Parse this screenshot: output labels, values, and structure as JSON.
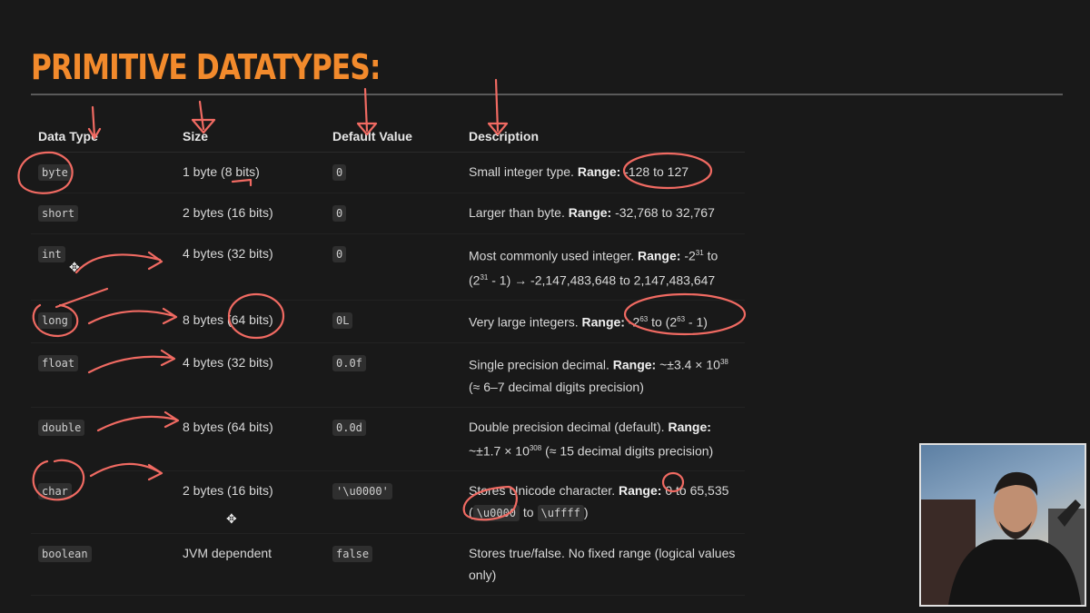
{
  "title": "PRIMITIVE DATATYPES:",
  "headers": {
    "data_type": "Data Type",
    "size": "Size",
    "default_value": "Default Value",
    "description": "Description"
  },
  "rows": [
    {
      "type": "byte",
      "size": "1 byte (8 bits)",
      "default": "0",
      "desc": "Small integer type. ",
      "range": "-128 to 127"
    },
    {
      "type": "short",
      "size": "2 bytes (16 bits)",
      "default": "0",
      "desc": "Larger than byte. ",
      "range": "-32,768 to 32,767"
    },
    {
      "type": "int",
      "size": "4 bytes (32 bits)",
      "default": "0",
      "desc": "Most commonly used integer. ",
      "range_a": "-2",
      "range_sup": "31",
      "range_b": " to (2",
      "range_sup2": "31",
      "range_c": " - 1) → -2,147,483,648 to 2,147,483,647"
    },
    {
      "type": "long",
      "size": "8 bytes (64 bits)",
      "default": "0L",
      "desc": "Very large integers. ",
      "range_a": "-2",
      "range_sup": "63",
      "range_b": " to (2",
      "range_sup2": "63",
      "range_c": " - 1)"
    },
    {
      "type": "float",
      "size": "4 bytes (32 bits)",
      "default": "0.0f",
      "desc": "Single precision decimal. ",
      "range_a": "~±3.4 × 10",
      "range_sup": "38",
      "range_c": " (≈ 6–7 decimal digits precision)"
    },
    {
      "type": "double",
      "size": "8 bytes (64 bits)",
      "default": "0.0d",
      "desc": "Double precision decimal (default). ",
      "range_a": "~±1.7 × 10",
      "range_sup": "308",
      "range_c": " (≈ 15 decimal digits precision)"
    },
    {
      "type": "char",
      "size": "2 bytes (16 bits)",
      "default": "'\\u0000'",
      "desc": "Stores Unicode character. ",
      "range_a": "0 to 65,535 (",
      "code_a": "\\u0000",
      "mid": " to ",
      "code_b": "\\uffff",
      "range_c": ")"
    },
    {
      "type": "boolean",
      "size": "JVM dependent",
      "default": "false",
      "desc": "Stores true/false. No fixed range (logical values only)"
    }
  ],
  "range_label": "Range:",
  "colors": {
    "title": "#f28a2c",
    "background": "#191919",
    "annotation": "#f06a62"
  }
}
